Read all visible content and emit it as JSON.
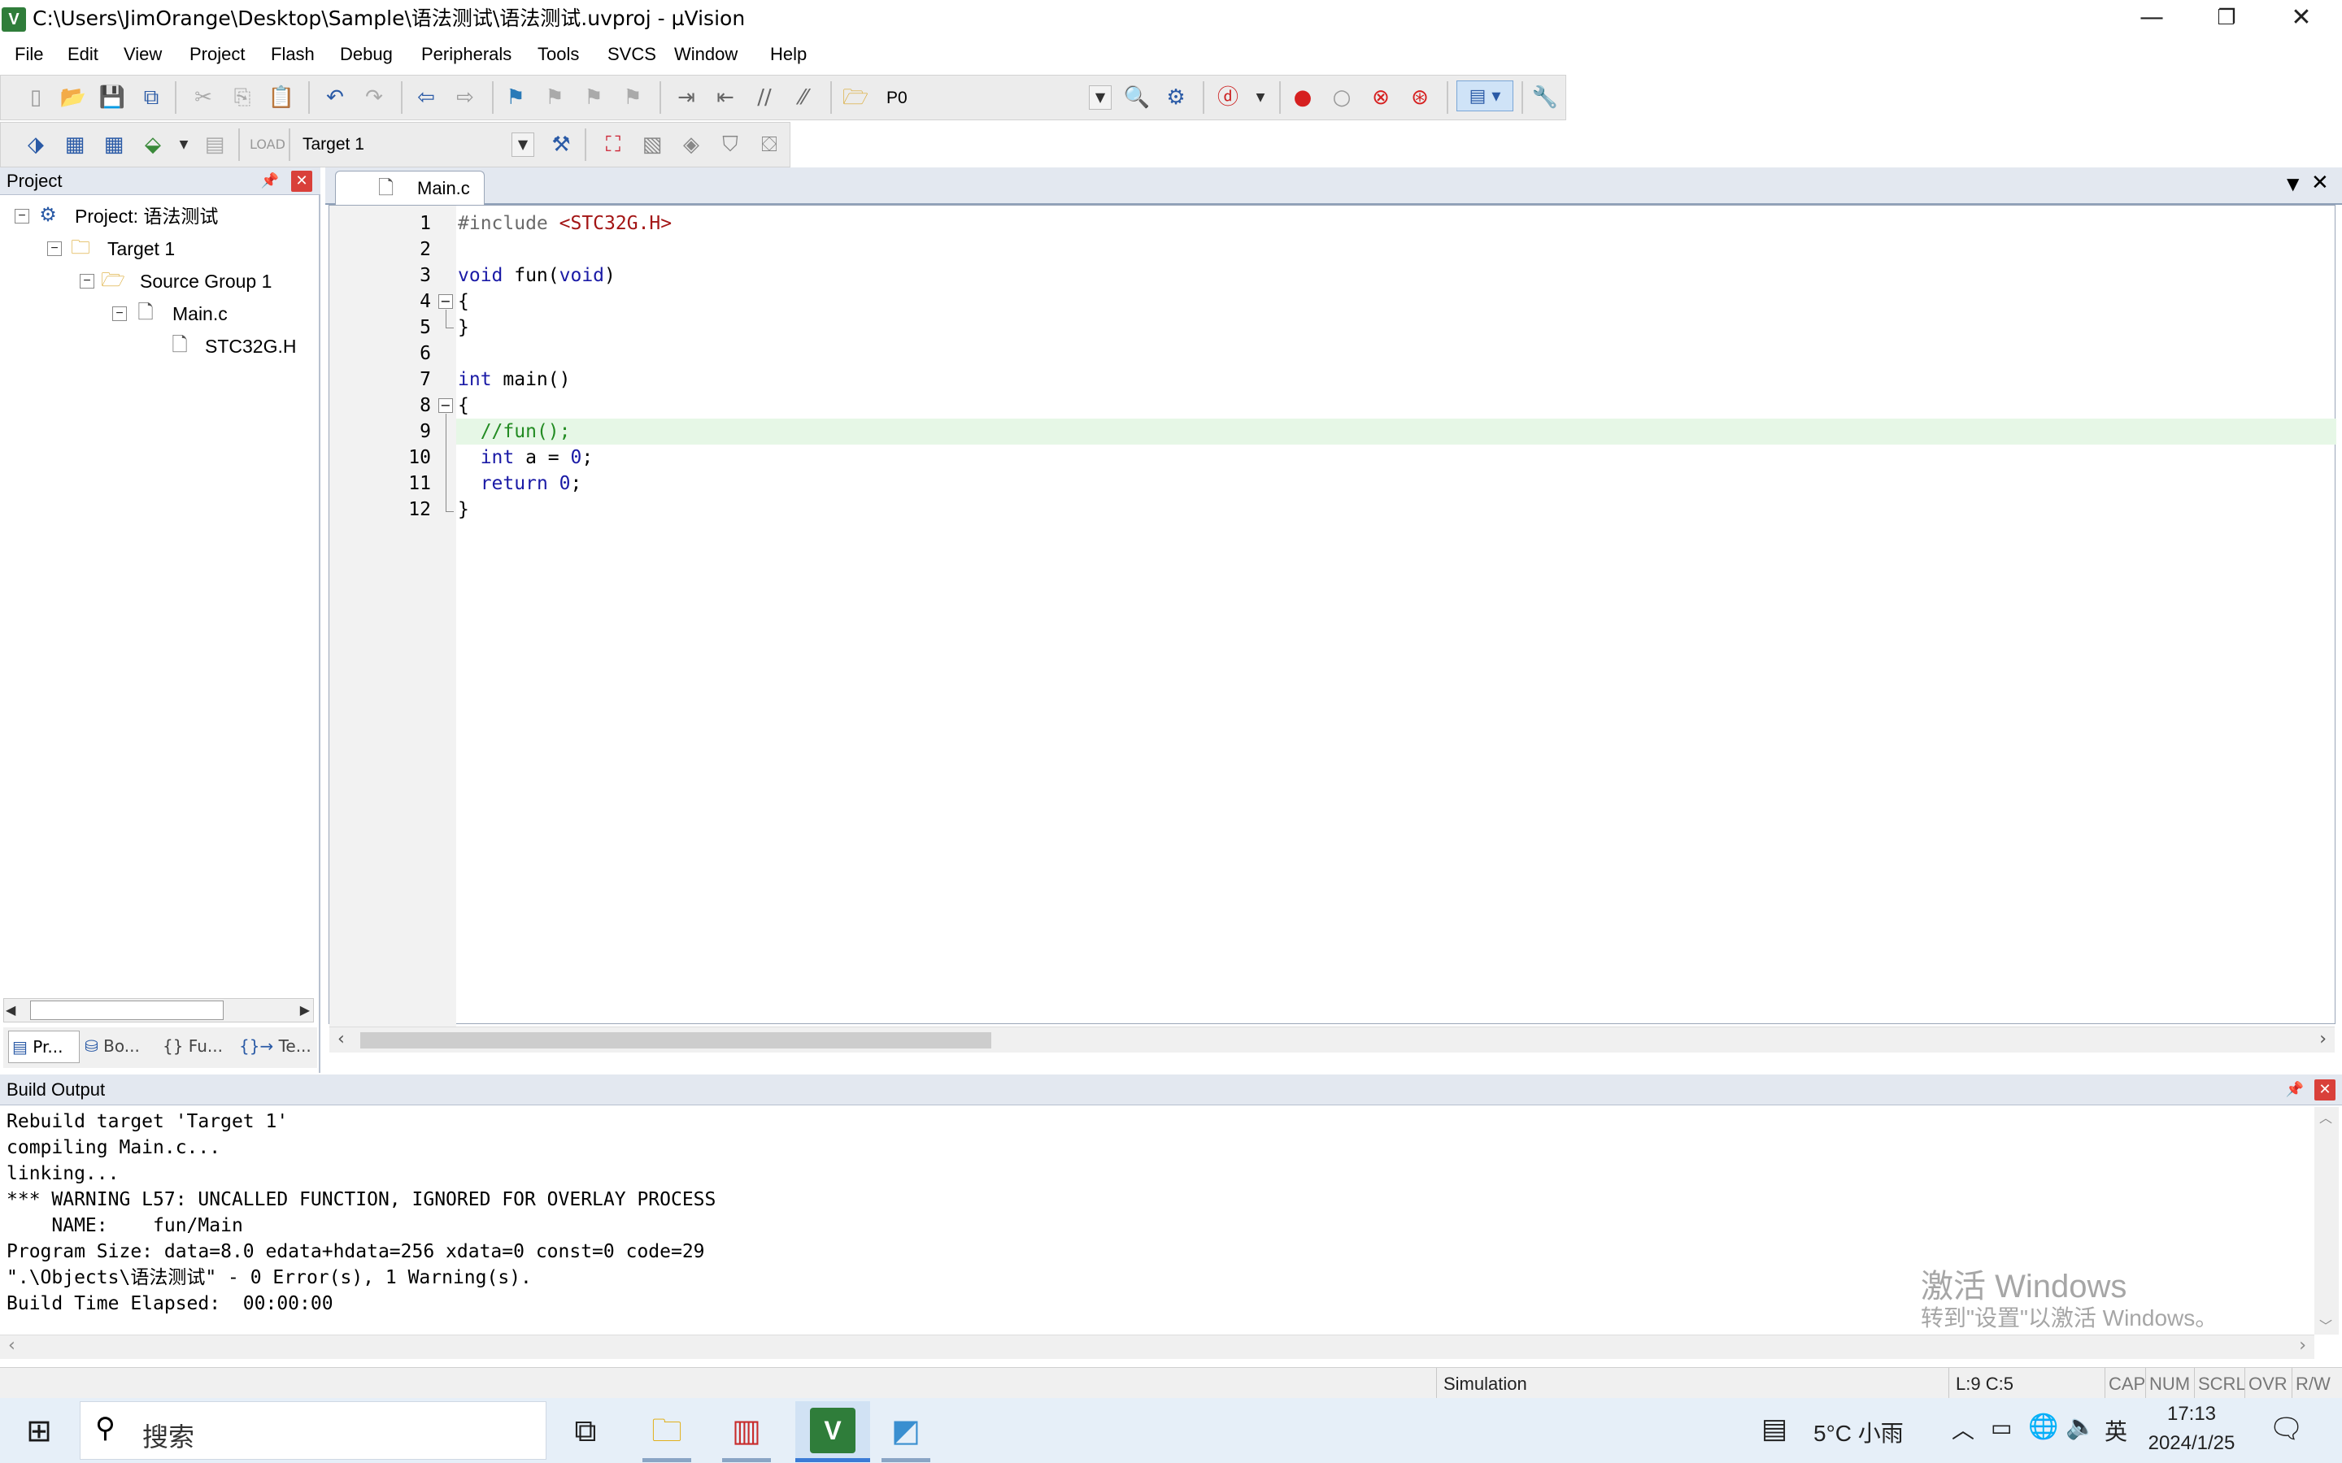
{
  "window": {
    "title": "C:\\Users\\JimOrange\\Desktop\\Sample\\语法测试\\语法测试.uvproj - µVision",
    "app_icon": "V",
    "minimize_glyph": "—",
    "restore_glyph": "❐",
    "close_glyph": "✕"
  },
  "menu": [
    "File",
    "Edit",
    "View",
    "Project",
    "Flash",
    "Debug",
    "Peripherals",
    "Tools",
    "SVCS",
    "Window",
    "Help"
  ],
  "toolbar1": {
    "find_value": "P0"
  },
  "toolbar2": {
    "target_select": "Target 1"
  },
  "project_panel": {
    "title": "Project",
    "tree": [
      {
        "label": "Project: 语法测试",
        "icon": "project-icon"
      },
      {
        "label": "Target 1",
        "icon": "target-folder-icon"
      },
      {
        "label": "Source Group 1",
        "icon": "folder-icon"
      },
      {
        "label": "Main.c",
        "icon": "c-file-icon"
      },
      {
        "label": "STC32G.H",
        "icon": "header-file-icon"
      }
    ],
    "tabs": [
      "Pr...",
      "Bo...",
      "{} Fu...",
      "Te..."
    ]
  },
  "editor": {
    "tab": "Main.c",
    "line_numbers": [
      "1",
      "2",
      "3",
      "4",
      "5",
      "6",
      "7",
      "8",
      "9",
      "10",
      "11",
      "12"
    ],
    "cursor_line": 9
  },
  "build_output": {
    "title": "Build Output",
    "lines": [
      "Rebuild target 'Target 1'",
      "compiling Main.c...",
      "linking...",
      "*** WARNING L57: UNCALLED FUNCTION, IGNORED FOR OVERLAY PROCESS",
      "    NAME:    fun/Main",
      "Program Size: data=8.0 edata+hdata=256 xdata=0 const=0 code=29",
      "\".\\Objects\\语法测试\" - 0 Error(s), 1 Warning(s).",
      "Build Time Elapsed:  00:00:00"
    ],
    "watermark_title": "激活 Windows",
    "watermark_sub": "转到\"设置\"以激活 Windows。"
  },
  "status_bar": {
    "mode": "Simulation",
    "position": "L:9 C:5",
    "cap": "CAP",
    "num": "NUM",
    "scrl": "SCRL",
    "ovr": "OVR",
    "rw": "R/W"
  },
  "taskbar": {
    "search_placeholder": "搜索",
    "weather": "5°C  小雨",
    "ime": "英",
    "time": "17:13",
    "date": "2024/1/25"
  },
  "colors": {
    "current_line": "#e6f7e6",
    "panel_header": "#e3e8f0",
    "taskbar": "#e6eff8",
    "accent": "#3a7bd5"
  }
}
